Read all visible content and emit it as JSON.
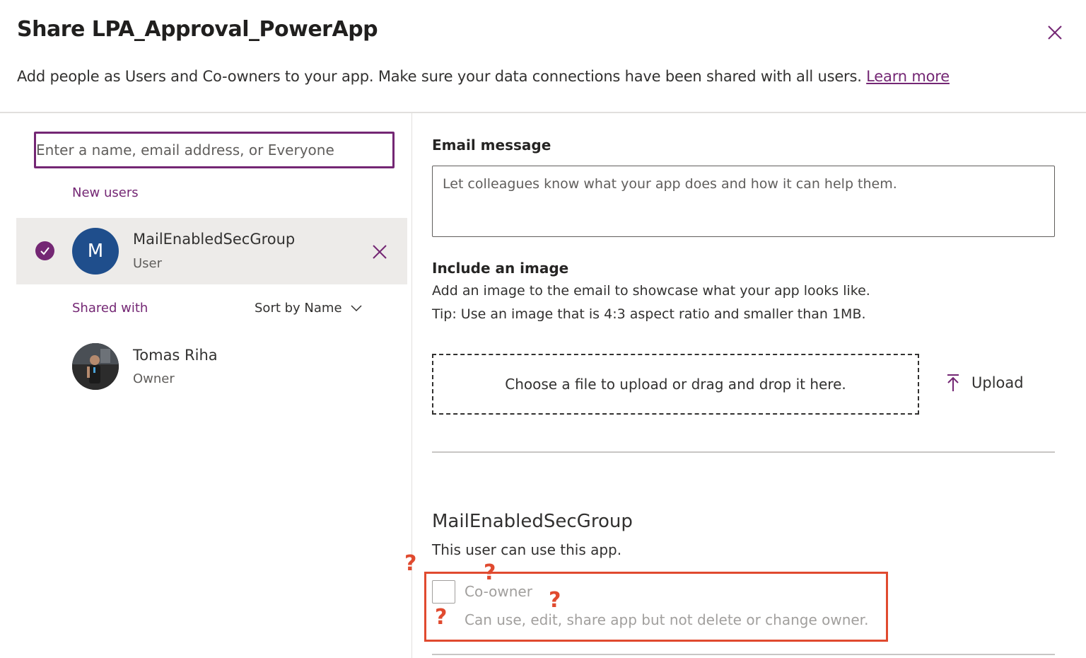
{
  "dialog": {
    "title": "Share LPA_Approval_PowerApp",
    "subtitle": "Add people as Users and Co-owners to your app. Make sure your data connections have been shared with all users.",
    "learn_more": "Learn more"
  },
  "left": {
    "search_placeholder": "Enter a name, email address, or Everyone",
    "new_users_label": "New users",
    "new_user": {
      "initial": "M",
      "name": "MailEnabledSecGroup",
      "role": "User",
      "selected": true,
      "avatar_color": "#1f4e8c"
    },
    "shared_with_label": "Shared with",
    "sort_label": "Sort by Name",
    "shared_user": {
      "name": "Tomas Riha",
      "role": "Owner"
    }
  },
  "right": {
    "email_heading": "Email message",
    "email_placeholder": "Let colleagues know what your app does and how it can help them.",
    "image_heading": "Include an image",
    "image_desc": "Add an image to the email to showcase what your app looks like.",
    "image_tip": "Tip: Use an image that is 4:3 aspect ratio and smaller than 1MB.",
    "dropzone_text": "Choose a file to upload or drag and drop it here.",
    "upload_label": "Upload",
    "permission": {
      "name": "MailEnabledSecGroup",
      "desc": "This user can use this app.",
      "coowner_label": "Co-owner",
      "coowner_desc": "Can use, edit, share app but not delete or change owner.",
      "coowner_checked": false
    }
  },
  "annotations": {
    "question_mark": "?"
  },
  "colors": {
    "accent": "#742774",
    "annotation": "#e04a2f",
    "disabled_text": "#a19f9d"
  },
  "icons": [
    "close-icon",
    "check-icon",
    "remove-icon",
    "chevron-down-icon",
    "upload-icon"
  ]
}
